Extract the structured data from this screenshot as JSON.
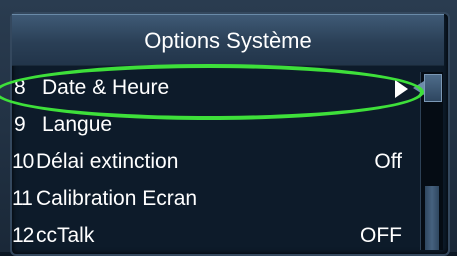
{
  "header": {
    "title": "Options Système"
  },
  "menu": {
    "items": [
      {
        "number": "8",
        "label": "Date & Heure",
        "value": "",
        "has_submenu": true
      },
      {
        "number": "9",
        "label": "Langue",
        "value": ""
      },
      {
        "number": "10",
        "label": "Délai extinction",
        "value": "Off"
      },
      {
        "number": "11",
        "label": "Calibration Ecran",
        "value": ""
      },
      {
        "number": "12",
        "label": "ccTalk",
        "value": "OFF"
      }
    ]
  },
  "colors": {
    "highlight": "#3ee03a",
    "header": "#2a3f56",
    "background": "#0d1b2a"
  },
  "icons": {
    "submenu": "submenu-arrow-icon",
    "scroll_up": "scroll-up-icon"
  }
}
